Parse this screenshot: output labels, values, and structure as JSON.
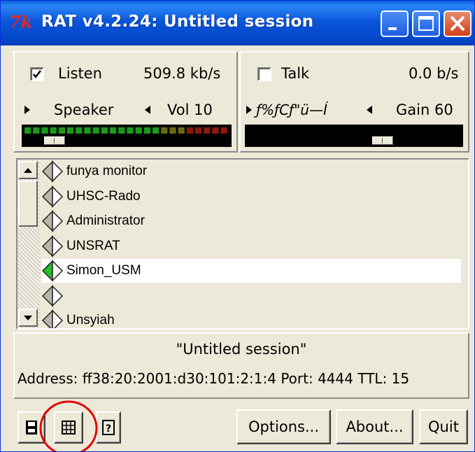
{
  "window": {
    "title": "RAT v4.2.24: Untitled session",
    "icon_text": "7k",
    "controls": [
      "minimize-icon",
      "maximize-icon",
      "close-icon"
    ]
  },
  "listen": {
    "checkbox_label": "Listen",
    "checked": true,
    "rate": "509.8 kb/s",
    "device": "Speaker",
    "volume_label": "Vol 10",
    "volume_level": 10
  },
  "talk": {
    "checkbox_label": "Talk",
    "checked": false,
    "rate": "0.0 b/s",
    "device": "ƒ%ƒCƒ\"ü—Í",
    "gain_label": "Gain 60",
    "gain_level": 60
  },
  "participants": [
    {
      "name": "funya monitor",
      "active": false
    },
    {
      "name": "UHSC-Rado",
      "active": false
    },
    {
      "name": "Administrator",
      "active": false
    },
    {
      "name": "UNSRAT",
      "active": false
    },
    {
      "name": "Simon_USM",
      "active": true
    },
    {
      "name": "",
      "active": false
    },
    {
      "name": "Unsyiah",
      "active": false
    }
  ],
  "session": {
    "name": "\"Untitled session\"",
    "address_line": "Address: ff38:20:2001:d30:101:2:1:4 Port: 4444 TTL: 15"
  },
  "toolbar": {
    "icons": [
      "save-icon",
      "grid-icon",
      "help-icon"
    ],
    "help_glyph": "?",
    "options_label": "Options...",
    "about_label": "About...",
    "quit_label": "Quit"
  },
  "colors": {
    "titlebar": "#0a56db",
    "meter_green": "#1a9a1a",
    "meter_red": "#8c1a0a",
    "active_speaker": "#22c022",
    "annotation_circle": "#e00000"
  }
}
